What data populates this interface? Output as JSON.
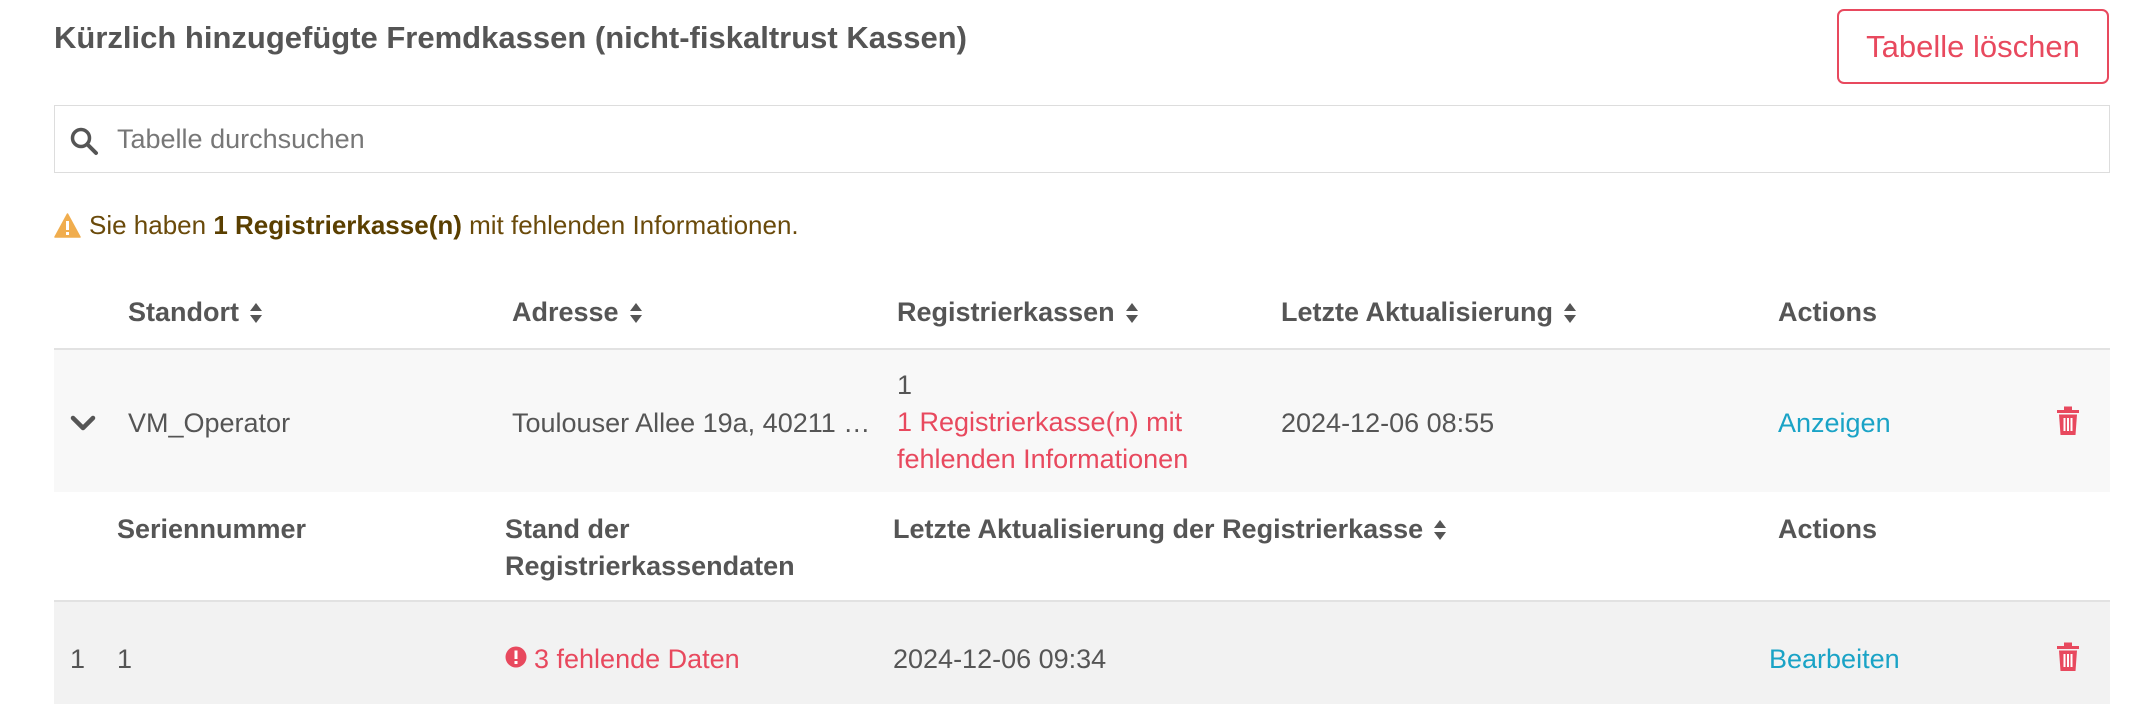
{
  "header": {
    "title": "Kürzlich hinzugefügte Fremdkassen (nicht-fiskaltrust Kassen)",
    "clear_button": "Tabelle löschen"
  },
  "search": {
    "placeholder": "Tabelle durchsuchen",
    "value": ""
  },
  "alert": {
    "prefix": "Sie haben ",
    "highlight": "1 Registrierkasse(n)",
    "suffix": " mit fehlenden Informationen."
  },
  "table": {
    "columns": [
      "Standort",
      "Adresse",
      "Registrierkassen",
      "Letzte Aktualisierung",
      "Actions"
    ],
    "rows": [
      {
        "standort": "VM_Operator",
        "adresse": "Toulouser Allee 19a, 40211 …",
        "count": "1",
        "missing_line1": "1 Registrierkasse(n) mit",
        "missing_line2": "fehlenden Informationen",
        "updated": "2024-12-06 08:55",
        "action": "Anzeigen"
      }
    ]
  },
  "subtable": {
    "columns": {
      "serial": "Seriennummer",
      "status_line1": "Stand der",
      "status_line2": "Registrierkassendaten",
      "updated": "Letzte Aktualisierung der Registrierkasse",
      "actions": "Actions"
    },
    "rows": [
      {
        "index": "1",
        "serial": "1",
        "status": "3 fehlende Daten",
        "updated": "2024-12-06 09:34",
        "action": "Bearbeiten"
      }
    ]
  },
  "colors": {
    "accent_red": "#e8495e",
    "link": "#1aa3c6",
    "warning": "#f0ad4e"
  }
}
